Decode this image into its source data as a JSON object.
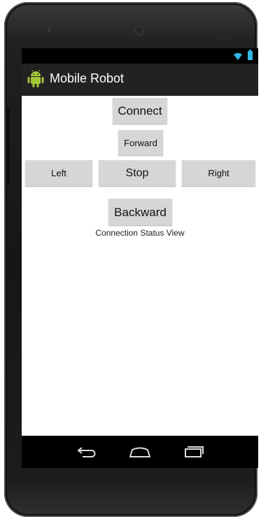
{
  "app": {
    "title": "Mobile Robot"
  },
  "controls": {
    "connect_label": "Connect",
    "forward_label": "Forward",
    "left_label": "Left",
    "stop_label": "Stop",
    "right_label": "Right",
    "backward_label": "Backward"
  },
  "status": {
    "text": "Connection Status View"
  },
  "statusbar": {
    "icons": [
      "wifi-icon",
      "battery-icon"
    ]
  },
  "navbar": {
    "icons": [
      "back-icon",
      "home-icon",
      "recent-apps-icon"
    ]
  },
  "colors": {
    "actionbar_bg": "#222222",
    "button_bg": "#d6d6d6",
    "accent": "#33b5e5",
    "android_green": "#a4c639"
  }
}
